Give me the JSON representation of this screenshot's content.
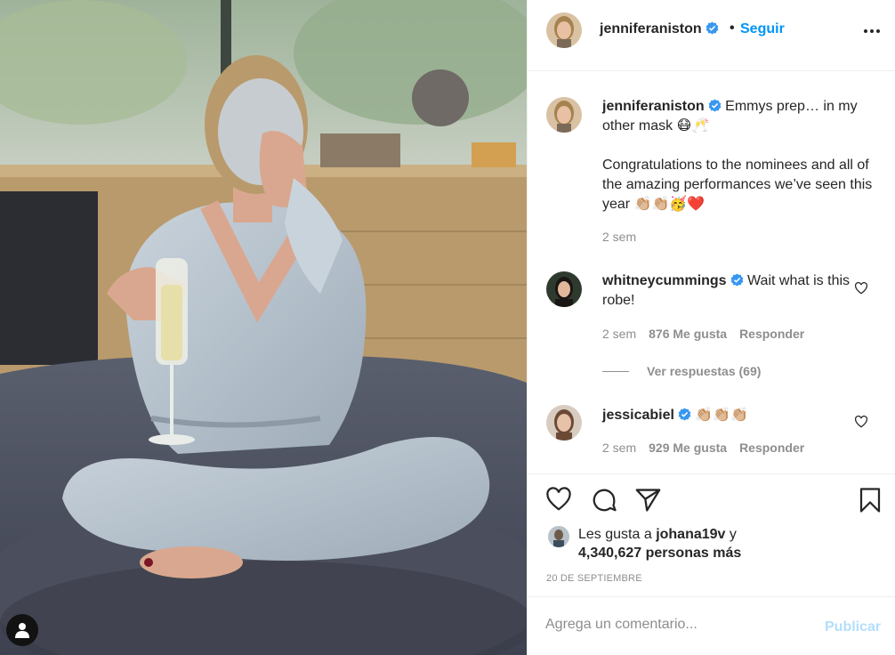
{
  "post": {
    "author": "jenniferaniston",
    "follow_label": "Seguir",
    "dot": "•",
    "icons": {
      "verified": "verified-badge-icon",
      "more": "more-options-icon",
      "like": "heart-outline-icon",
      "comment": "speech-bubble-icon",
      "share": "paper-plane-icon",
      "save": "bookmark-icon",
      "user_tag": "person-icon"
    }
  },
  "caption": {
    "username": "jenniferaniston",
    "text": "Emmys prep… in my other mask 😷🥂",
    "body": "Congratulations to the nominees and all of the amazing performances we’ve seen this year 👏🏼👏🏼🥳❤️",
    "time": "2 sem"
  },
  "comments": [
    {
      "username": "whitneycummings",
      "text": "Wait what is this robe!",
      "time": "2 sem",
      "likes": "876 Me gusta",
      "reply_label": "Responder",
      "view_replies": "Ver respuestas (69)"
    },
    {
      "username": "jessicabiel",
      "text": "👏🏼👏🏼👏🏼",
      "time": "2 sem",
      "likes": "929 Me gusta",
      "reply_label": "Responder"
    }
  ],
  "likes": {
    "prefix": "Les gusta a",
    "user": "johana19v",
    "connector": "y",
    "others": "4,340,627 personas más"
  },
  "date": "20 DE SEPTIEMBRE",
  "comment_box": {
    "placeholder": "Agrega un comentario...",
    "publish_label": "Publicar"
  },
  "colors": {
    "accent": "#0095f6",
    "publish_disabled": "#b2dffc",
    "secondary_text": "#8e8e8e",
    "verified": "#3897f0"
  }
}
